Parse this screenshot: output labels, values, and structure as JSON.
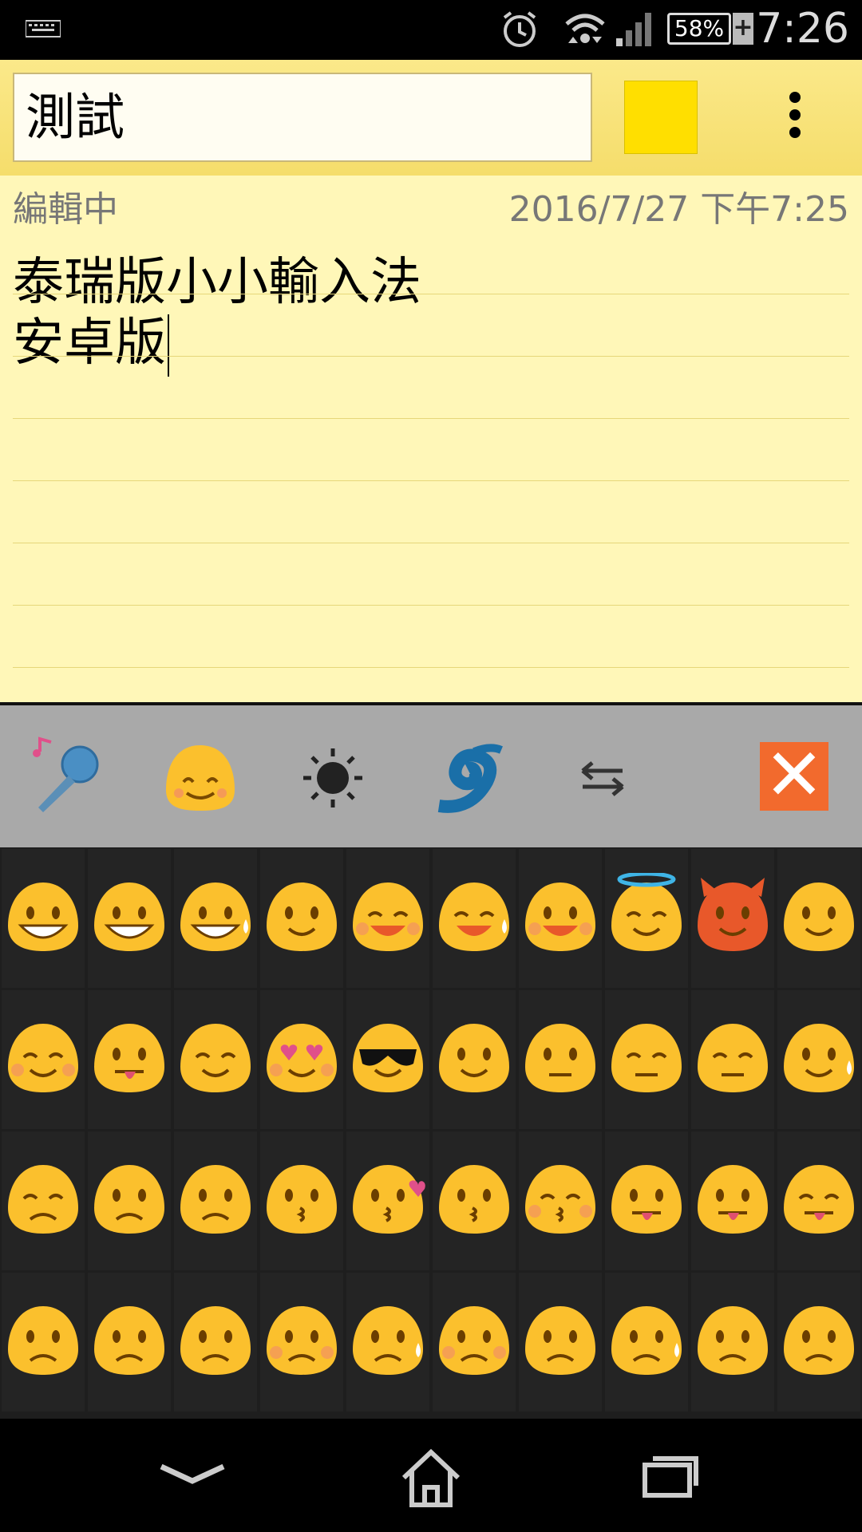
{
  "status_bar": {
    "battery_percent": "58%",
    "battery_plus": "+",
    "time": "7:26",
    "icons": [
      "keyboard-icon",
      "alarm-icon",
      "wifi-icon",
      "signal-icon",
      "battery-icon"
    ]
  },
  "note": {
    "title": "測試",
    "color": "#ffdf00",
    "status": "編輯中",
    "datetime": "2016/7/27 下午7:25",
    "lines": [
      "泰瑞版小小輸入法",
      "安卓版"
    ]
  },
  "keyboard_toolbar": {
    "buttons": [
      "microphone-icon",
      "emoji-icon",
      "brightness-icon",
      "swirl-icon",
      "switch-arrows-icon",
      "close-icon"
    ],
    "close_label": "✕",
    "switch_label": "⇆"
  },
  "emoji_rows": [
    [
      "grin",
      "grin-wide",
      "tears-of-joy",
      "smile",
      "laugh-blush",
      "sweat-smile",
      "wink-laugh",
      "halo",
      "devil",
      "wink"
    ],
    [
      "blush",
      "yum",
      "relieved",
      "heart-eyes",
      "sunglasses",
      "smirk",
      "neutral-side",
      "expressionless",
      "unamused",
      "sweat"
    ],
    [
      "pensive",
      "confused",
      "confounded",
      "kissing",
      "kiss-heart",
      "kiss-smile",
      "kiss-closed",
      "tongue",
      "tongue-wink",
      "tongue-closed"
    ],
    [
      "disappointed",
      "worried",
      "angry",
      "pout",
      "sad-tear",
      "persevere",
      "triumph",
      "disappointed-relieved",
      "tired",
      "weary"
    ]
  ],
  "nav_bar": {
    "icons": [
      "back-chevron-icon",
      "home-icon",
      "recents-icon"
    ]
  }
}
